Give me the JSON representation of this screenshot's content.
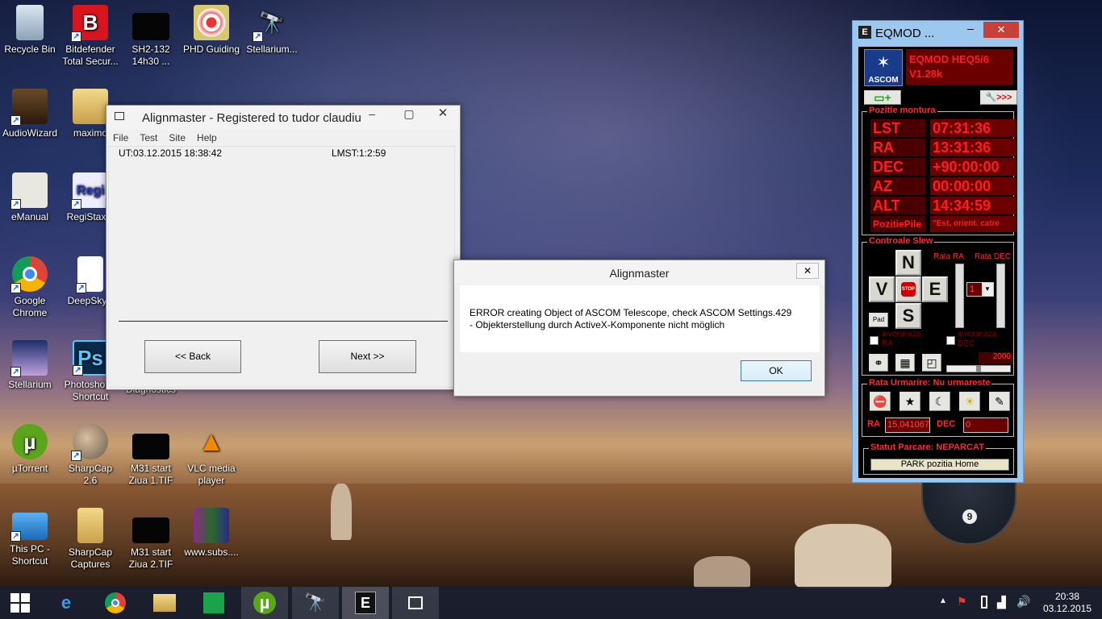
{
  "desktop_icons": [
    {
      "label": "Recycle Bin"
    },
    {
      "label": "Bitdefender Total Secur..."
    },
    {
      "label": "SH2-132 14h30 ..."
    },
    {
      "label": "PHD Guiding"
    },
    {
      "label": "Stellarium..."
    },
    {
      "label": "AudioWizard"
    },
    {
      "label": "maximo"
    },
    {
      "label": "eManual"
    },
    {
      "label": "RegiStax 5"
    },
    {
      "label": "Google Chrome"
    },
    {
      "label": "DeepSkyS"
    },
    {
      "label": "Stellarium"
    },
    {
      "label": "Photoshop - Shortcut"
    },
    {
      "label": "Diagnostics"
    },
    {
      "label": "µTorrent"
    },
    {
      "label": "SharpCap 2.6"
    },
    {
      "label": "M31 start Ziua 1.TIF"
    },
    {
      "label": "VLC media player"
    },
    {
      "label": "This PC - Shortcut"
    },
    {
      "label": "SharpCap Captures"
    },
    {
      "label": "M31 start Ziua 2.TIF"
    },
    {
      "label": "www.subs...."
    }
  ],
  "alignmaster": {
    "title": "Alignmaster - Registered to tudor claudiu",
    "menu": [
      "File",
      "Test",
      "Site",
      "Help"
    ],
    "ut": "UT:03.12.2015 18:38:42",
    "lmst": "LMST:1:2:59",
    "back": "<< Back",
    "next": "Next >>"
  },
  "dialog": {
    "title": "Alignmaster",
    "message": "ERROR creating Object of ASCOM Telescope, check ASCOM Settings.429 - Objekterstellung durch ActiveX-Komponente nicht möglich",
    "ok": "OK"
  },
  "eqmod": {
    "title": "EQMOD ...",
    "brand": "ASCOM",
    "version_line1": "EQMOD HEQ5/6",
    "version_line2": "V1.28k",
    "pos_group": "Pozitie montura",
    "rows": [
      {
        "label": "LST",
        "value": "07:31:36"
      },
      {
        "label": "RA",
        "value": "13:31:36"
      },
      {
        "label": "DEC",
        "value": "+90:00:00"
      },
      {
        "label": "AZ",
        "value": "00:00:00"
      },
      {
        "label": "ALT",
        "value": "14:34:59"
      }
    ],
    "pier_label": "PozitiePile",
    "pier_value": "\"Est, orient. catre",
    "slew_group": "Controale Slew",
    "n": "N",
    "s": "S",
    "e": "E",
    "w": "V",
    "stop": "STOP",
    "pad": "Pad",
    "rate_ra": "Rata RA",
    "rate_dec": "Rata DEC",
    "rate_select": "1",
    "inv_ra": "inverseaza RA",
    "inv_dec": "inverseaza DEC",
    "slider_value": "2000",
    "track_group": "Rata Urmarire: Nu urmareste",
    "track_ra_label": "RA",
    "track_ra": "15,041067",
    "track_dec_label": "DEC",
    "track_dec": "0",
    "park_group": "Statut Parcare: NEPARCAT",
    "park_button": "PARK pozitia Home"
  },
  "taskbar": {
    "time": "20:38",
    "date": "03.12.2015"
  },
  "gadget": {
    "number": "9"
  }
}
